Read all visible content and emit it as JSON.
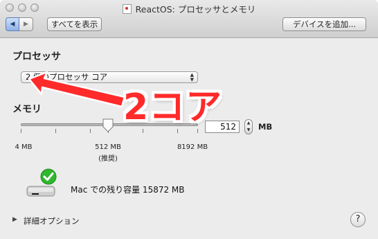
{
  "window": {
    "title": "ReactOS: プロセッサとメモリ"
  },
  "toolbar": {
    "back_glyph": "◀",
    "forward_glyph": "▶",
    "show_all_label": "すべてを表示",
    "add_device_label": "デバイスを追加..."
  },
  "processor": {
    "section_title": "プロセッサ",
    "selected_option": "2 個のプロセッサ コア",
    "popup_arrows": "▲\n▼"
  },
  "memory": {
    "section_title": "メモリ",
    "value": "512",
    "unit": "MB",
    "slider": {
      "min_label": "4 MB",
      "mid_label": "512 MB",
      "mid_sub_label": "(推奨)",
      "max_label": "8192 MB",
      "current_mb": 512
    },
    "stepper_up": "▲",
    "stepper_down": "▼"
  },
  "remaining": {
    "text": "Mac での残り容量 15872 MB"
  },
  "advanced": {
    "disclosure_glyph": "▶",
    "label": "詳細オプション"
  },
  "help": {
    "label": "?"
  },
  "annotation": {
    "text": "2コア",
    "color": "#ff2a2a"
  },
  "colors": {
    "accent": "#5d7fb8",
    "check_green": "#2fb72f"
  }
}
